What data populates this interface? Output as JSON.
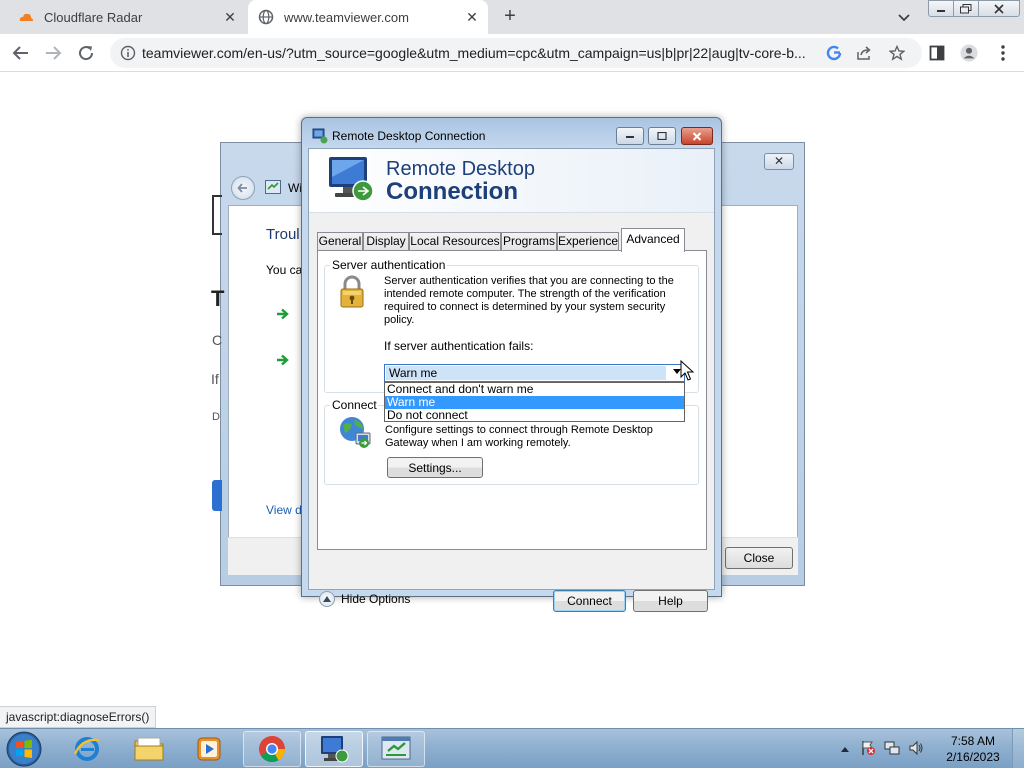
{
  "browser": {
    "tabs": [
      {
        "title": "Cloudflare Radar",
        "icon": "cloudflare-icon"
      },
      {
        "title": "www.teamviewer.com",
        "icon": "globe-icon"
      }
    ],
    "url": "teamviewer.com/en-us/?utm_source=google&utm_medium=cpc&utm_campaign=us|b|pr|22|aug|tv-core-b...",
    "status_text": "javascript:diagnoseErrors()"
  },
  "background_window": {
    "title": "Wi",
    "heading": "Troul",
    "line1": "You ca",
    "big_letter": "T",
    "text_c": "C",
    "text_if": "If",
    "text_d": "D",
    "link": "View d",
    "close_label": "Close"
  },
  "rdc": {
    "title": "Remote Desktop Connection",
    "banner_line1": "Remote Desktop",
    "banner_line2": "Connection",
    "tabs": [
      "General",
      "Display",
      "Local Resources",
      "Programs",
      "Experience",
      "Advanced"
    ],
    "active_tab": "Advanced",
    "server_auth": {
      "group_label": "Server authentication",
      "description": "Server authentication verifies that you are connecting to the intended remote computer. The strength of the verification required to connect is determined by your system security policy.",
      "fail_label": "If server authentication fails:",
      "selected": "Warn me",
      "options": [
        "Connect and don't warn me",
        "Warn me",
        "Do not connect"
      ]
    },
    "connect_from": {
      "group_label": "Connect from anywhere",
      "description": "Configure settings to connect through Remote Desktop Gateway when I am working remotely.",
      "settings_label": "Settings..."
    },
    "hide_options_label": "Hide Options",
    "connect_label": "Connect",
    "help_label": "Help"
  },
  "taskbar": {
    "time": "7:58 AM",
    "date": "2/16/2023"
  }
}
